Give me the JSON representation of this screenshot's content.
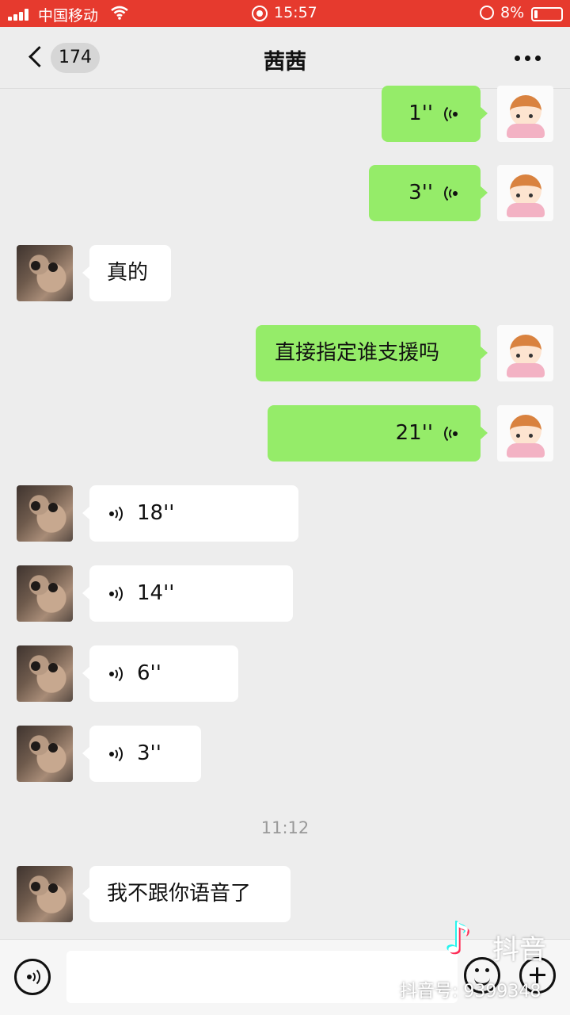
{
  "status_bar": {
    "carrier": "中国移动",
    "time": "15:57",
    "battery": "8%",
    "accent_color": "#e63a2e"
  },
  "nav": {
    "back_icon": "chevron-left-icon",
    "unread_count": "174",
    "title": "茜茜",
    "more_icon": "more-dots-icon"
  },
  "messages": [
    {
      "side": "out",
      "type": "voice",
      "duration": "1''"
    },
    {
      "side": "out",
      "type": "voice",
      "duration": "3''"
    },
    {
      "side": "in",
      "type": "text",
      "text": "真的"
    },
    {
      "side": "out",
      "type": "text",
      "text": "直接指定谁支援吗"
    },
    {
      "side": "out",
      "type": "voice",
      "duration": "21''"
    },
    {
      "side": "in",
      "type": "voice",
      "duration": "18''"
    },
    {
      "side": "in",
      "type": "voice",
      "duration": "14''"
    },
    {
      "side": "in",
      "type": "voice",
      "duration": "6''"
    },
    {
      "side": "in",
      "type": "voice",
      "duration": "3''"
    },
    {
      "side": "in",
      "type": "text",
      "text": "我不跟你语音了"
    }
  ],
  "timestamp": "11:12",
  "input_bar": {
    "voice_icon": "voice-toggle-icon",
    "emoji_icon": "emoji-icon",
    "plus_icon": "plus-icon"
  },
  "watermark": {
    "brand": "抖音",
    "account": "抖音号: 9399348"
  },
  "colors": {
    "outgoing_bubble": "#95ec69",
    "incoming_bubble": "#ffffff",
    "background": "#ededed"
  }
}
